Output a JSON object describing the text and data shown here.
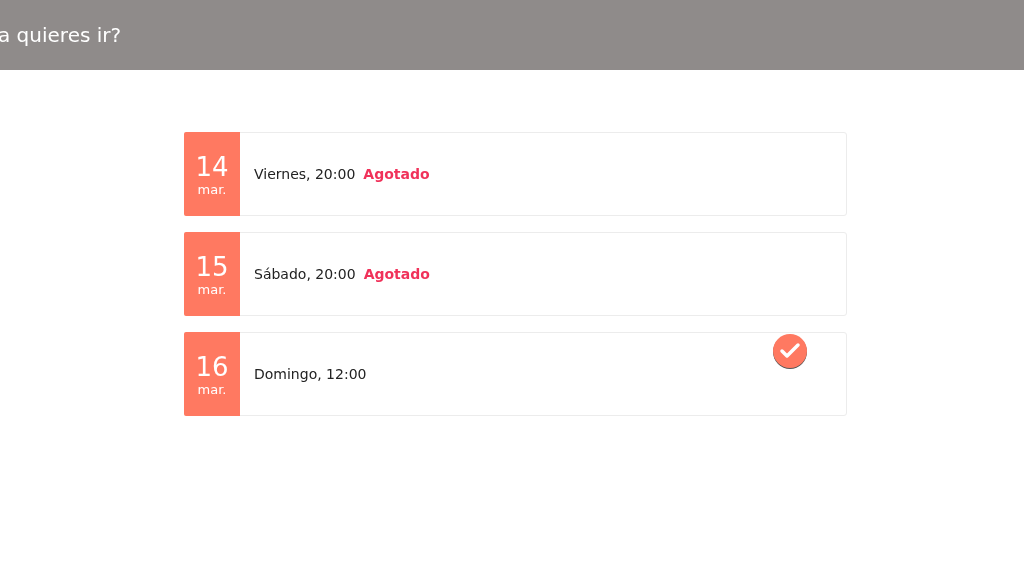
{
  "header": {
    "title": "a quieres ir?"
  },
  "sessions": [
    {
      "day": "14",
      "month": "mar.",
      "label": "Viernes, 20:00",
      "status": "Agotado",
      "selected": false
    },
    {
      "day": "15",
      "month": "mar.",
      "label": "Sábado, 20:00",
      "status": "Agotado",
      "selected": false
    },
    {
      "day": "16",
      "month": "mar.",
      "label": "Domingo, 12:00",
      "selected": true
    }
  ]
}
